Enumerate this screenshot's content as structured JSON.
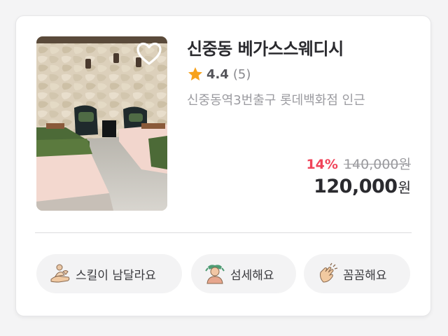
{
  "listing": {
    "name": "신중동 베가스스웨디시",
    "rating": "4.4",
    "reviews": "(5)",
    "address": "신중동역3번출구 롯데백화점 인근",
    "discount": "14%",
    "original_price": "140,000원",
    "final_price": "120,000",
    "currency": "원"
  },
  "tags": [
    {
      "label": "스킬이 남달라요",
      "icon": "hand-massage-icon"
    },
    {
      "label": "섬세해요",
      "icon": "person-massage-icon"
    },
    {
      "label": "꼼꼼해요",
      "icon": "clapping-hands-icon"
    }
  ],
  "colors": {
    "discount": "#f0445a",
    "star": "#f7a21b",
    "tag_bg": "#f3f3f4"
  }
}
